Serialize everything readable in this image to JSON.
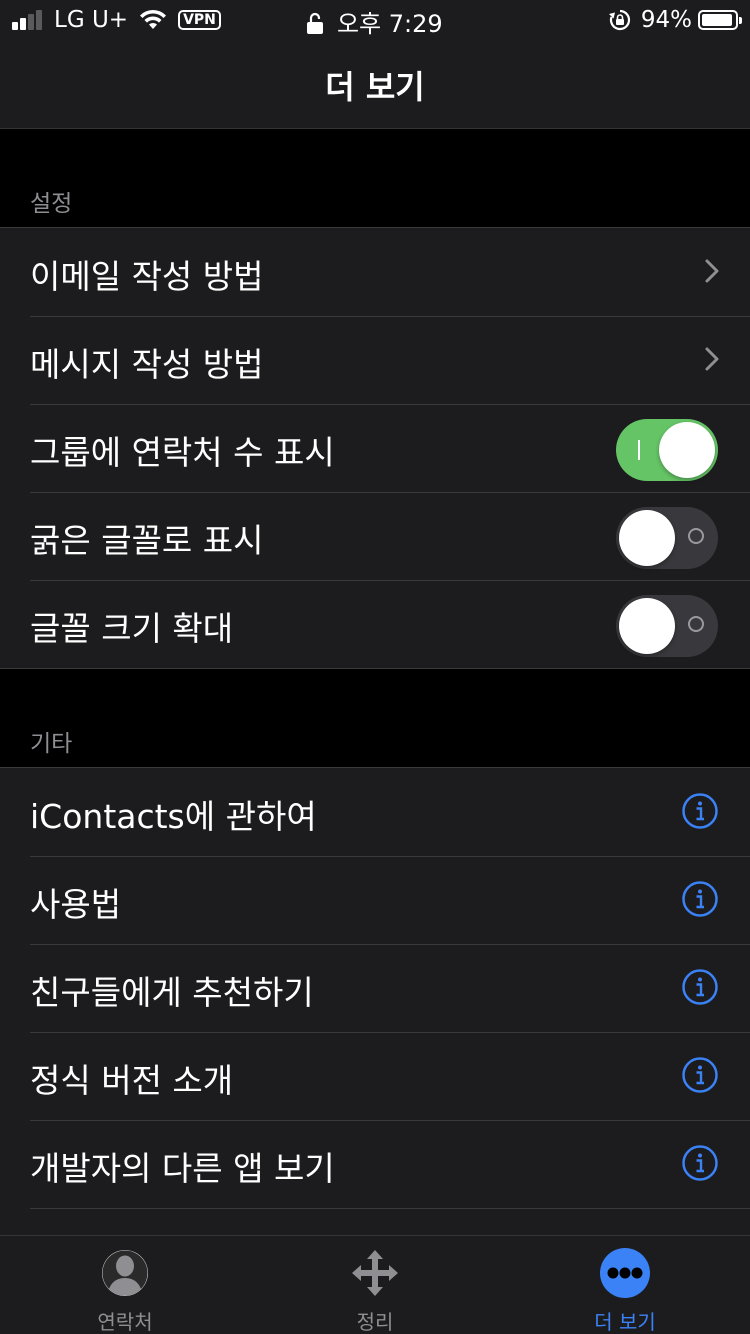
{
  "status_bar": {
    "carrier": "LG U+",
    "vpn": "VPN",
    "time": "오후 7:29",
    "battery_percent": "94%",
    "battery_level": 0.94
  },
  "nav": {
    "title": "더 보기"
  },
  "settings": {
    "header": "설정",
    "rows": [
      {
        "label": "이메일 작성 방법",
        "accessory": "chevron-right-icon"
      },
      {
        "label": "메시지 작성 방법",
        "accessory": "chevron-right-icon"
      },
      {
        "label": "그룹에 연락처 수 표시",
        "toggle": true
      },
      {
        "label": "굵은 글꼴로 표시",
        "toggle": false
      },
      {
        "label": "글꼴 크기 확대",
        "toggle": false
      }
    ]
  },
  "other": {
    "header": "기타",
    "rows": [
      {
        "label": "iContacts에 관하여",
        "accessory": "info-icon"
      },
      {
        "label": "사용법",
        "accessory": "info-icon"
      },
      {
        "label": "친구들에게 추천하기",
        "accessory": "info-icon"
      },
      {
        "label": "정식 버전 소개",
        "accessory": "info-icon"
      },
      {
        "label": "개발자의 다른 앱 보기",
        "accessory": "info-icon"
      }
    ]
  },
  "tab_bar": {
    "tabs": [
      {
        "label": "연락처",
        "icon": "contacts-icon",
        "active": false
      },
      {
        "label": "정리",
        "icon": "move-arrows-icon",
        "active": false
      },
      {
        "label": "더 보기",
        "icon": "more-dots-icon",
        "active": true
      }
    ]
  },
  "colors": {
    "accent": "#3b82f6",
    "toggle_on": "#65c466",
    "toggle_off": "#39393d",
    "cell_background": "#1c1c1e"
  }
}
